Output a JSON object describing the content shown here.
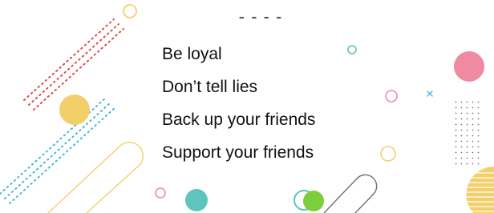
{
  "header": {
    "dashes": "- - - -"
  },
  "rules": [
    {
      "label": "Be loyal"
    },
    {
      "label": "Don’t tell lies"
    },
    {
      "label": "Back up your friends"
    },
    {
      "label": "Support your friends"
    }
  ],
  "colors": {
    "yellow": "#f3cf6a",
    "pink": "#f08aa3",
    "teal": "#5dc4bf",
    "green": "#7ccf3b",
    "red_dots": "#e24a4a",
    "blue_dots": "#49b7e0",
    "gray_line": "#6f6f6f",
    "dark_dots": "#777777"
  },
  "icons": [
    "circle-outline-icon",
    "dot-pattern-icon",
    "plus-icon",
    "diagonal-line-icon"
  ]
}
